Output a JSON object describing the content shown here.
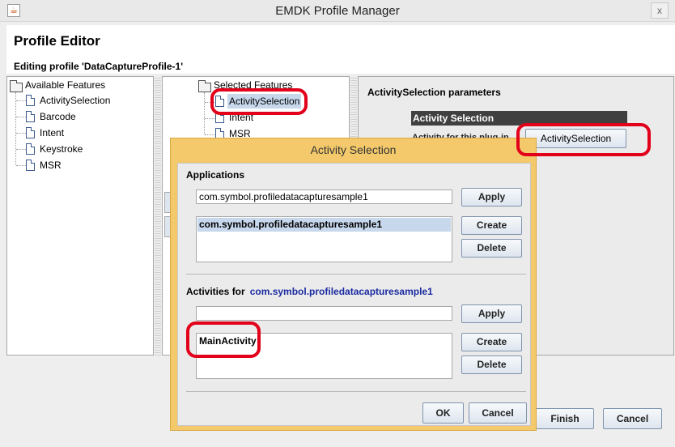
{
  "window": {
    "title": "EMDK Profile Manager",
    "close_glyph": "x"
  },
  "editor": {
    "title": "Profile Editor",
    "subtitle": "Editing profile 'DataCaptureProfile-1'"
  },
  "available_features": {
    "root_label": "Available Features",
    "items": [
      "ActivitySelection",
      "Barcode",
      "Intent",
      "Keystroke",
      "MSR"
    ]
  },
  "selected_features": {
    "root_label": "Selected Features",
    "items": [
      "ActivitySelection",
      "Intent",
      "MSR"
    ]
  },
  "parameters": {
    "title": "ActivitySelection parameters",
    "header": "Activity Selection",
    "row_label": "Activity for this plug-in",
    "value_button": "ActivitySelection"
  },
  "footer": {
    "finish_label": "Finish",
    "cancel_label": "Cancel"
  },
  "dialog": {
    "title": "Activity Selection",
    "applications": {
      "label": "Applications",
      "input_value": "com.symbol.profiledatacapturesample1",
      "apply_label": "Apply",
      "list": [
        "com.symbol.profiledatacapturesample1"
      ],
      "create_label": "Create",
      "delete_label": "Delete"
    },
    "activities": {
      "label": "Activities for",
      "package": "com.symbol.profiledatacapturesample1",
      "input_value": "",
      "apply_label": "Apply",
      "list": [
        "MainActivity"
      ],
      "create_label": "Create",
      "delete_label": "Delete"
    },
    "ok_label": "OK",
    "cancel_label": "Cancel"
  },
  "icons": {
    "app": "java-cup-icon",
    "folder": "folder-icon",
    "document": "document-icon",
    "close": "close-icon"
  },
  "colors": {
    "dialog_frame": "#f3c96b",
    "highlight": "#e2001a",
    "param_header": "#404040",
    "selection": "#c7d7ec",
    "package_text": "#1a2aa0"
  }
}
